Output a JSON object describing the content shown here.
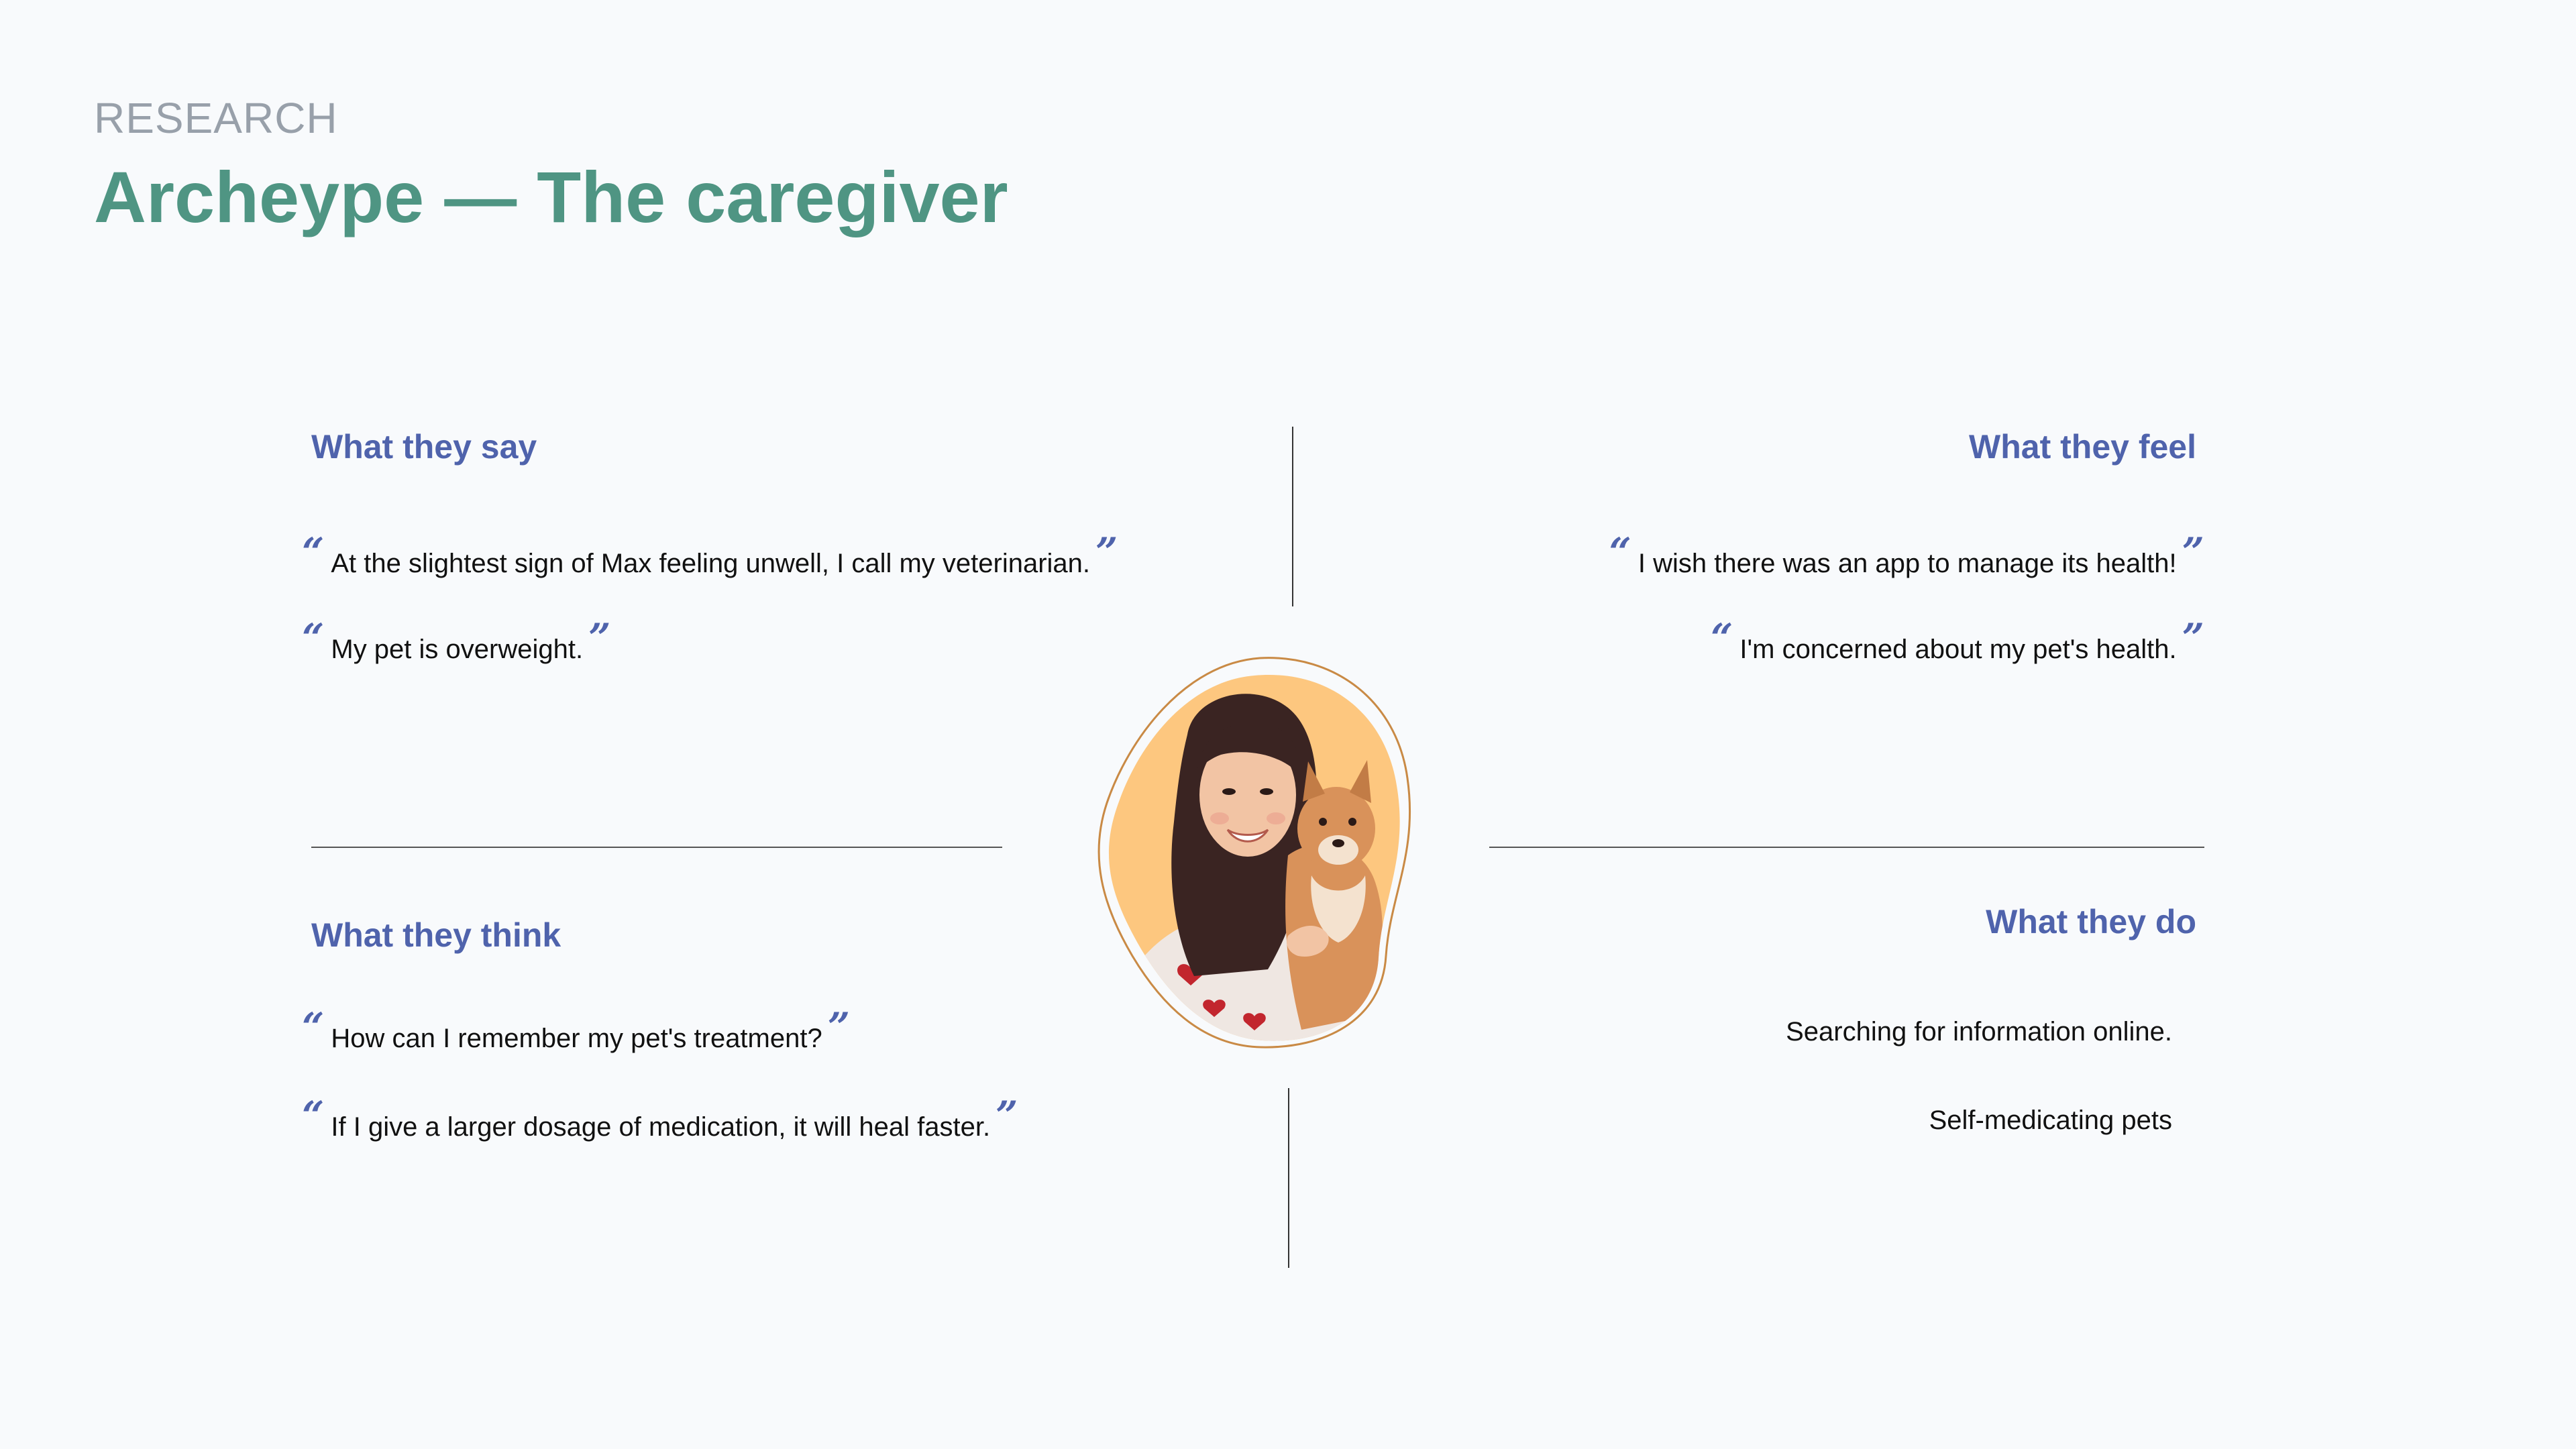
{
  "header": {
    "eyebrow": "RESEARCH",
    "title": "Archeype — The caregiver"
  },
  "quadrants": {
    "say": {
      "heading": "What they say",
      "quotes": [
        "At the slightest sign of Max feeling unwell, I call my veterinarian.",
        "My pet is overweight."
      ]
    },
    "feel": {
      "heading": "What they feel",
      "quotes": [
        "I wish there was an app to manage its health!",
        "I'm concerned about my pet's health."
      ]
    },
    "think": {
      "heading": "What they think",
      "quotes": [
        "How can I remember my pet's treatment?",
        "If I give a larger dosage of medication, it will heal faster."
      ]
    },
    "do": {
      "heading": "What they do",
      "items": [
        "Searching for information online.",
        "Self-medicating pets"
      ]
    }
  },
  "glyphs": {
    "open_quote": "“",
    "close_quote": "”"
  },
  "colors": {
    "title": "#4f9583",
    "heading": "#4f63ac",
    "eyebrow": "#98a0aa",
    "blob_fill": "#fdc77f",
    "blob_outline": "#c98a45"
  },
  "avatar": {
    "icon": "persona-photo-woman-with-dog-icon"
  }
}
